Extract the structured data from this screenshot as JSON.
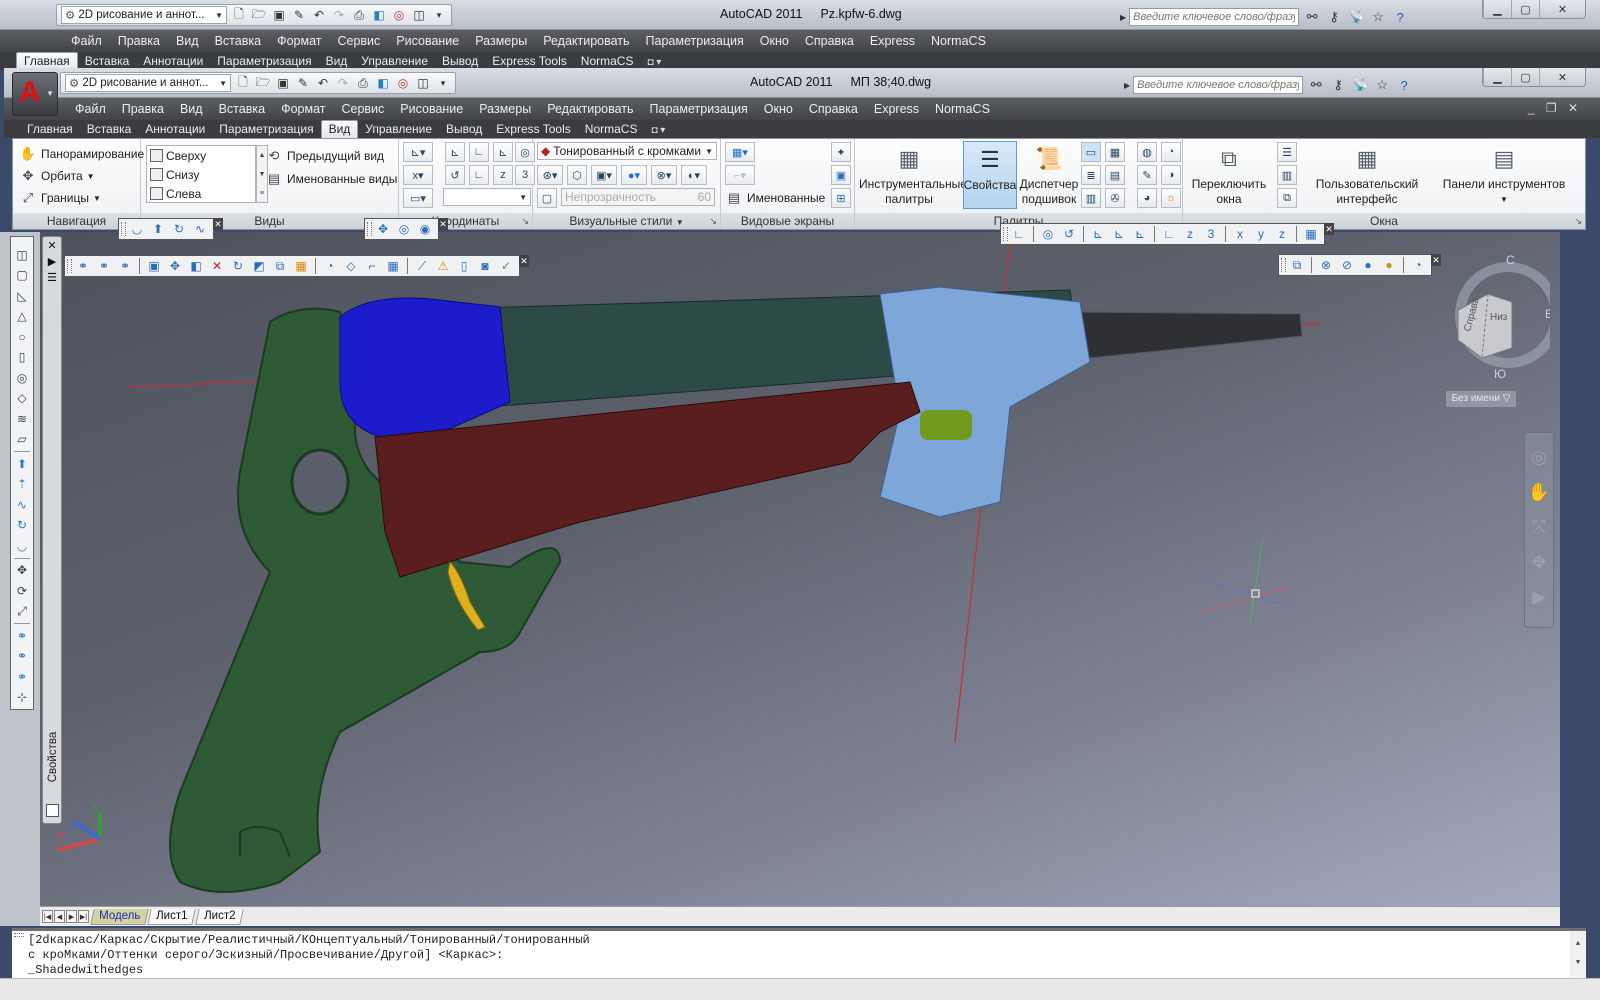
{
  "window_back": {
    "workspace": "2D рисование и аннот...",
    "app_title": "AutoCAD 2011",
    "file_name": "Pz.kpfw-6.dwg",
    "search_placeholder": "Введите ключевое слово/фразу",
    "menu": [
      "Файл",
      "Правка",
      "Вид",
      "Вставка",
      "Формат",
      "Сервис",
      "Рисование",
      "Размеры",
      "Редактировать",
      "Параметризация",
      "Окно",
      "Справка",
      "Express",
      "NormaCS"
    ],
    "tabs": [
      "Главная",
      "Вставка",
      "Аннотации",
      "Параметризация",
      "Вид",
      "Управление",
      "Вывод",
      "Express Tools",
      "NormaCS"
    ],
    "active_tab": "Главная"
  },
  "window_front": {
    "workspace": "2D рисование и аннот...",
    "app_title": "AutoCAD 2011",
    "file_name": "МП 38;40.dwg",
    "search_placeholder": "Введите ключевое слово/фразу",
    "menu": [
      "Файл",
      "Правка",
      "Вид",
      "Вставка",
      "Формат",
      "Сервис",
      "Рисование",
      "Размеры",
      "Редактировать",
      "Параметризация",
      "Окно",
      "Справка",
      "Express",
      "NormaCS"
    ],
    "tabs": [
      "Главная",
      "Вставка",
      "Аннотации",
      "Параметризация",
      "Вид",
      "Управление",
      "Вывод",
      "Express Tools",
      "NormaCS"
    ],
    "active_tab": "Вид"
  },
  "icons": {
    "qat": [
      "new-icon",
      "open-icon",
      "save-icon",
      "save-as-icon",
      "undo-icon",
      "redo-icon",
      "plot-icon",
      "3d-box-icon",
      "orbit-globe-icon",
      "cube-icon",
      "dropdown-icon"
    ],
    "search_tools": [
      "binoculars-icon",
      "key-icon",
      "satellite-icon",
      "star-icon",
      "help-icon"
    ]
  },
  "ribbon": {
    "navigation": {
      "label": "Навигация",
      "items": [
        "Панорамирование",
        "Орбита",
        "Границы"
      ]
    },
    "views": {
      "label": "Виды",
      "list": [
        "Сверху",
        "Снизу",
        "Слева"
      ],
      "prev_view": "Предыдущий вид",
      "named_views": "Именованные виды"
    },
    "coordinates": {
      "label": "Координаты"
    },
    "visual_styles": {
      "label": "Визуальные стили",
      "current_style": "Тонированный с кромками",
      "opacity_label": "Непрозрачность",
      "opacity_value": "60"
    },
    "viewports": {
      "label": "Видовые экраны",
      "named": "Именованные"
    },
    "palettes": {
      "label": "Палитры",
      "tool_palettes": "Инструментальные палитры",
      "properties": "Свойства",
      "sheet_set": "Диспетчер подшивок"
    },
    "windows": {
      "label": "Окна",
      "switch_windows": "Переключить окна",
      "user_interface": "Пользовательский интерфейс",
      "toolbars": "Панели инструментов"
    }
  },
  "viewport": {
    "viewcube_faces": [
      "Справа",
      "Низ"
    ],
    "viewcube_compass": [
      "С",
      "В",
      "Ю"
    ],
    "ucs_name": "Без имени",
    "properties_palette_label": "Свойства",
    "ucs_axes": [
      "X",
      "Y",
      "Z"
    ]
  },
  "layout_tabs": [
    "Модель",
    "Лист1",
    "Лист2"
  ],
  "active_layout": "Модель",
  "command_line": [
    "[2dкаркас/Каркас/Скрытие/Реалистичный/КОнцептуальный/Тонированный/тонированный",
    "с кроМками/Оттенки серого/Эскизный/Просвечивание/Другой] <Каркас>:",
    "_Shadedwithedges"
  ],
  "colors": {
    "menubar_bg": "#4a4d52",
    "grip_green": "#2f5a36",
    "stock_red": "#5a1e1e",
    "magazine_blue": "#1c1ccc",
    "receiver_blue": "#7ea6d8",
    "trigger_yellow": "#e0b020",
    "barrel_dark": "#2f3034"
  }
}
